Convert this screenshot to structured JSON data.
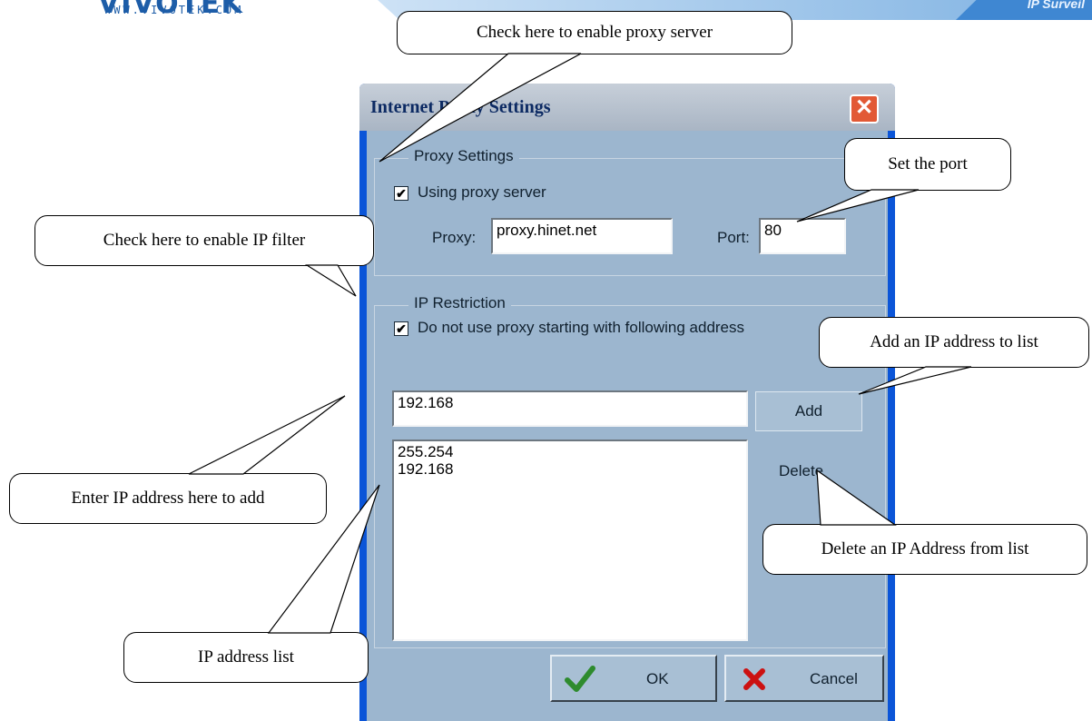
{
  "header": {
    "logo_text": "VIVOTEK",
    "logo_url": "WWW.VIVOTEK.COM",
    "tagline": "IP Surveil"
  },
  "dialog": {
    "title": "Internet Proxy Settings",
    "close_label": "✕",
    "proxy_group": {
      "legend": "Proxy Settings",
      "use_proxy_checked": true,
      "use_proxy_label": "Using proxy server",
      "proxy_label": "Proxy:",
      "proxy_value": "proxy.hinet.net",
      "port_label": "Port:",
      "port_value": "80"
    },
    "ip_group": {
      "legend": "IP Restriction",
      "bypass_checked": true,
      "bypass_label": "Do not use proxy starting with following address",
      "address_input_value": "192.168",
      "add_label": "Add",
      "delete_label": "Delete",
      "address_list": [
        "255.254",
        "192.168"
      ]
    },
    "ok_label": "OK",
    "cancel_label": "Cancel"
  },
  "callouts": {
    "enable_proxy": "Check here to enable proxy server",
    "set_port": "Set the port",
    "enable_ip_filter": "Check here to enable IP filter",
    "add_ip": "Add an IP address to list",
    "enter_ip": "Enter IP address here to add",
    "delete_ip": "Delete an IP Address from list",
    "ip_list": "IP address list"
  },
  "colors": {
    "window_frame": "#0b55d8",
    "client_bg": "#9cb6cf",
    "close_button": "#e25935",
    "ok_check": "#2e8b2e",
    "cancel_x": "#cc1111"
  },
  "icons": {
    "ok": "checkmark-icon",
    "cancel": "x-mark-icon",
    "close": "close-icon"
  }
}
